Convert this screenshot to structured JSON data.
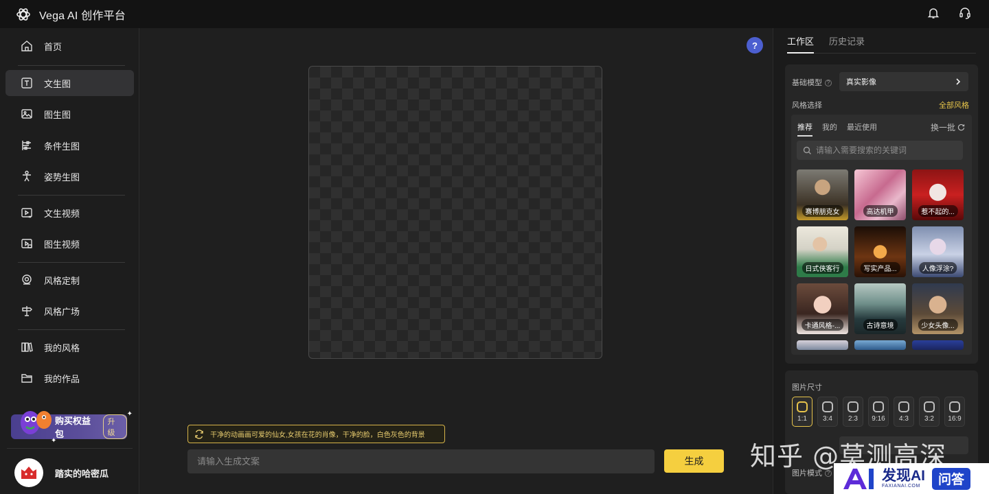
{
  "app": {
    "title": "Vega AI 创作平台"
  },
  "sidebar": {
    "items": [
      {
        "label": "首页",
        "icon": "home-icon"
      },
      {
        "label": "文生图",
        "icon": "text-icon",
        "active": true
      },
      {
        "label": "图生图",
        "icon": "image-icon"
      },
      {
        "label": "条件生图",
        "icon": "sliders-icon"
      },
      {
        "label": "姿势生图",
        "icon": "pose-icon"
      },
      {
        "label": "文生视频",
        "icon": "text-video-icon"
      },
      {
        "label": "图生视频",
        "icon": "image-video-icon"
      },
      {
        "label": "风格定制",
        "icon": "style-custom-icon"
      },
      {
        "label": "风格广场",
        "icon": "signpost-icon"
      },
      {
        "label": "我的风格",
        "icon": "books-icon"
      },
      {
        "label": "我的作品",
        "icon": "folder-icon"
      }
    ],
    "promo": {
      "label": "购买权益包",
      "badge": "升级"
    },
    "user": {
      "name": "踏实的哈密瓜"
    }
  },
  "main": {
    "help_label": "?",
    "prompt_suggestion": "干净的动画画可爱的仙女,女孩在花的肖像，干净的脸，白色灰色的背景",
    "input_placeholder": "请输入生成文案",
    "generate_label": "生成"
  },
  "panel": {
    "tabs": [
      {
        "label": "工作区",
        "active": true
      },
      {
        "label": "历史记录",
        "active": false
      }
    ],
    "base_model_label": "基础模型",
    "base_model_value": "真实影像",
    "style_label": "风格选择",
    "all_styles": "全部风格",
    "style_tabs": [
      {
        "label": "推荐",
        "active": true
      },
      {
        "label": "我的",
        "active": false
      },
      {
        "label": "最近使用",
        "active": false
      }
    ],
    "refresh_label": "换一批",
    "search_placeholder": "请输入需要搜索的关键词",
    "styles": [
      {
        "label": "赛博朋克女"
      },
      {
        "label": "高达机甲"
      },
      {
        "label": "惹不起的..."
      },
      {
        "label": "日式侠客行"
      },
      {
        "label": "写实产品..."
      },
      {
        "label": "人像浮涂?"
      },
      {
        "label": "卡通风格-..."
      },
      {
        "label": "古诗意境"
      },
      {
        "label": "少女头像..."
      }
    ],
    "size_label": "图片尺寸",
    "sizes": [
      "1:1",
      "3:4",
      "2:3",
      "9:16",
      "4:3",
      "3:2",
      "16:9"
    ],
    "selected_size": "1:1",
    "mode_label": "图片模式"
  },
  "watermark": {
    "text": "知乎 @莫测高深",
    "brand_main": "发现AI",
    "brand_sub": "FAXIANAI.COM",
    "qa": "问答"
  },
  "colors": {
    "accent_yellow": "#f5cf3f",
    "help_blue": "#4c5fd0",
    "promo_purple": "#5b4e9a"
  }
}
